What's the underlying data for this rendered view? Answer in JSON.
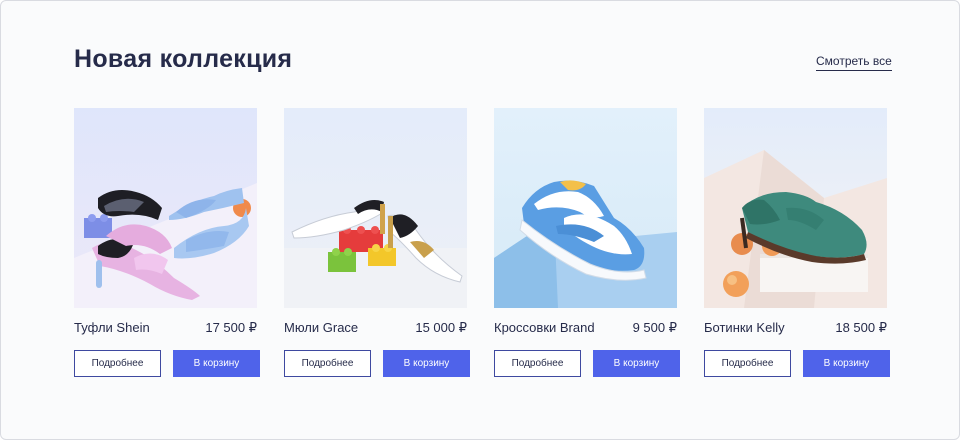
{
  "header": {
    "title": "Новая коллекция",
    "see_all": "Смотреть все"
  },
  "products": [
    {
      "name": "Туфли Shein",
      "price": "17 500 ₽",
      "details_label": "Подробнее",
      "cart_label": "В корзину",
      "image": "pastel-heeled-mules-photo"
    },
    {
      "name": "Мюли Grace",
      "price": "15 000 ₽",
      "details_label": "Подробнее",
      "cart_label": "В корзину",
      "image": "white-mules-on-toy-bricks-photo"
    },
    {
      "name": "Кроссовки Brand",
      "price": "9 500 ₽",
      "details_label": "Подробнее",
      "cart_label": "В корзину",
      "image": "blue-sneaker-photo"
    },
    {
      "name": "Ботинки Kelly",
      "price": "18 500 ₽",
      "details_label": "Подробнее",
      "cart_label": "В корзину",
      "image": "green-suede-oxford-photo"
    }
  ],
  "colors": {
    "accent": "#4f63ea",
    "text": "#262b4a",
    "outline": "#3e49a0",
    "background": "#fafbfc"
  }
}
